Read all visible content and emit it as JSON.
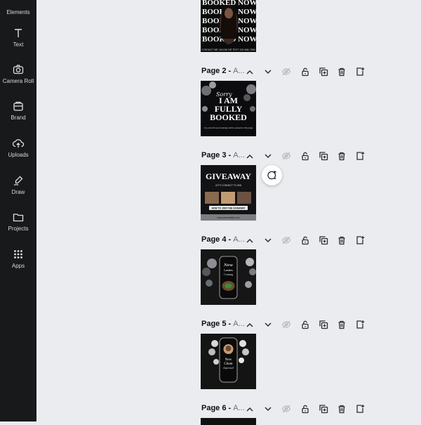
{
  "sidebar": {
    "items": [
      {
        "label": "Elements",
        "icon": "elements-icon"
      },
      {
        "label": "Text",
        "icon": "text-icon"
      },
      {
        "label": "Camera Roll",
        "icon": "camera-icon"
      },
      {
        "label": "Brand",
        "icon": "brand-icon"
      },
      {
        "label": "Uploads",
        "icon": "upload-cloud-icon"
      },
      {
        "label": "Draw",
        "icon": "draw-pen-icon"
      },
      {
        "label": "Projects",
        "icon": "folder-icon"
      },
      {
        "label": "Apps",
        "icon": "apps-grid-icon"
      }
    ]
  },
  "pages": [
    {
      "title": "Page 2 -",
      "subtitle": "A..."
    },
    {
      "title": "Page 3 -",
      "subtitle": "A..."
    },
    {
      "title": "Page 4 -",
      "subtitle": "A..."
    },
    {
      "title": "Page 5 -",
      "subtitle": "A..."
    },
    {
      "title": "Page 6 -",
      "subtitle": "A..."
    }
  ],
  "thumbnails": {
    "page1": {
      "lines": [
        "BOOKED NOW",
        "BOOKED NOW",
        "BOOKED NOW",
        "BOOKED NOW",
        "BOOKED NOW"
      ],
      "contact": "CONTACT ME VIA DM OR TEXT 123-456-7890"
    },
    "page2": {
      "script": "Sorry",
      "heading1": "I AM",
      "heading2": "FULLY",
      "heading3": "BOOKED",
      "note": "Any and all new bookings will be posted to this page"
    },
    "page3": {
      "heading": "GIVEAWAY",
      "subtitle": "LET'S CONNECT TO WIN",
      "steps": "HOW TO JOIN THE GIVEAWAY",
      "footer": "www.yourwebsite.com"
    },
    "page4": {
      "line1": "New",
      "line2": "Lashes",
      "line3": "Coming"
    },
    "page5": {
      "line1": "New",
      "line2": "Client",
      "line3": "Special"
    }
  },
  "colors": {
    "sidebar_bg": "#18191b",
    "canvas_bg": "#ebecf0",
    "icon_dark": "#2b2d33",
    "icon_disabled": "#b5b8c0"
  }
}
